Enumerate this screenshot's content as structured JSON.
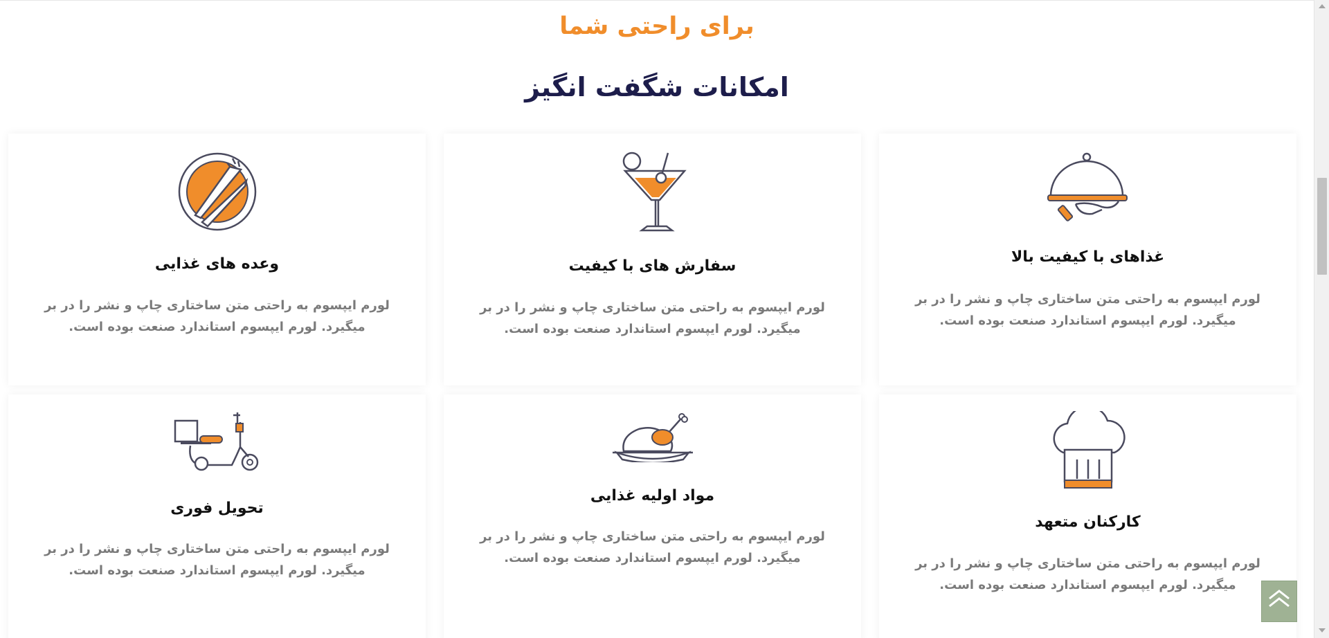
{
  "section": {
    "subtitle": "برای راحتی شما",
    "title": "امکانات شگفت انگیز"
  },
  "cards": [
    {
      "title": "غذاهای با کیفیت بالا",
      "text": "لورم ایپسوم به راحتی متن ساختاری چاپ و نشر را در بر میگیرد. لورم ایپسوم استاندارد صنعت بوده است.",
      "icon": "cloche-icon"
    },
    {
      "title": "سفارش های با کیفیت",
      "text": "لورم ایپسوم به راحتی متن ساختاری چاپ و نشر را در بر میگیرد. لورم ایپسوم استاندارد صنعت بوده است.",
      "icon": "cocktail-icon"
    },
    {
      "title": "وعده های غذایی",
      "text": "لورم ایپسوم به راحتی متن ساختاری چاپ و نشر را در بر میگیرد. لورم ایپسوم استاندارد صنعت بوده است.",
      "icon": "plate-cutlery-icon"
    },
    {
      "title": "کارکنان متعهد",
      "text": "لورم ایپسوم به راحتی متن ساختاری چاپ و نشر را در بر میگیرد. لورم ایپسوم استاندارد صنعت بوده است.",
      "icon": "chef-hat-icon"
    },
    {
      "title": "مواد اولیه غذایی",
      "text": "لورم ایپسوم به راحتی متن ساختاری چاپ و نشر را در بر میگیرد. لورم ایپسوم استاندارد صنعت بوده است.",
      "icon": "roast-chicken-icon"
    },
    {
      "title": "تحویل فوری",
      "text": "لورم ایپسوم به راحتی متن ساختاری چاپ و نشر را در بر میگیرد. لورم ایپسوم استاندارد صنعت بوده است.",
      "icon": "delivery-scooter-icon"
    }
  ],
  "colors": {
    "accent": "#f08d2b",
    "heading": "#1d1d4b",
    "body_text": "#7a7a7a",
    "icon_stroke": "#4a4a5e",
    "back_to_top": "#9fb294"
  },
  "back_to_top_icon": "double-chevron-up-icon"
}
